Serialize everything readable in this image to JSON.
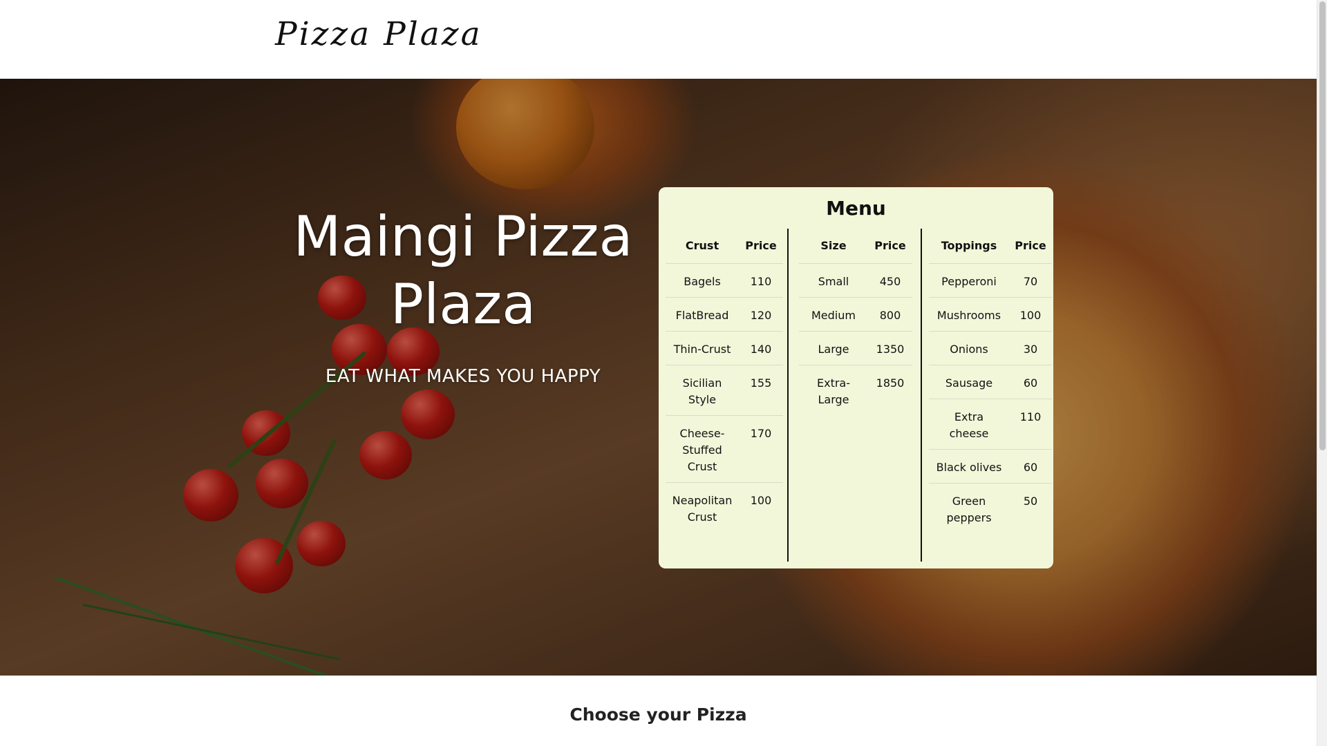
{
  "header": {
    "brand": "Pizza Plaza"
  },
  "hero": {
    "title": "Maingi Pizza Plaza",
    "tagline": "EAT WHAT MAKES YOU HAPPY"
  },
  "menu": {
    "title": "Menu",
    "crust": {
      "headers": [
        "Crust",
        "Price"
      ],
      "rows": [
        [
          "Bagels",
          "110"
        ],
        [
          "FlatBread",
          "120"
        ],
        [
          "Thin-Crust",
          "140"
        ],
        [
          "Sicilian Style",
          "155"
        ],
        [
          "Cheese-Stuffed Crust",
          "170"
        ],
        [
          "Neapolitan Crust",
          "100"
        ]
      ]
    },
    "size": {
      "headers": [
        "Size",
        "Price"
      ],
      "rows": [
        [
          "Small",
          "450"
        ],
        [
          "Medium",
          "800"
        ],
        [
          "Large",
          "1350"
        ],
        [
          "Extra-Large",
          "1850"
        ]
      ]
    },
    "toppings": {
      "headers": [
        "Toppings",
        "Price"
      ],
      "rows": [
        [
          "Pepperoni",
          "70"
        ],
        [
          "Mushrooms",
          "100"
        ],
        [
          "Onions",
          "30"
        ],
        [
          "Sausage",
          "60"
        ],
        [
          "Extra cheese",
          "110"
        ],
        [
          "Black olives",
          "60"
        ],
        [
          "Green peppers",
          "50"
        ]
      ]
    }
  },
  "section": {
    "choose_title": "Choose your Pizza"
  },
  "colors": {
    "menu_bg": "#f3f7da",
    "text": "#111111",
    "header_bg": "#ffffff"
  }
}
